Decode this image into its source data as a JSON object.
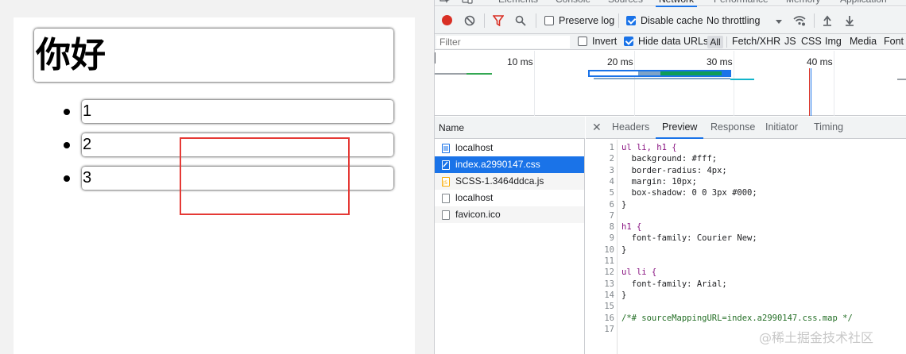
{
  "demo": {
    "heading": "你好",
    "items": [
      "1",
      "2",
      "3"
    ]
  },
  "devtools": {
    "main_tabs": [
      "Elements",
      "Console",
      "Sources",
      "Network",
      "Performance",
      "Memory",
      "Application"
    ],
    "active_main_tab": "Network",
    "toolbar": {
      "preserve_log": "Preserve log",
      "disable_cache": "Disable cache",
      "throttling": "No throttling"
    },
    "filter": {
      "placeholder": "Filter",
      "invert": "Invert",
      "hide_data_urls": "Hide data URLs",
      "types": [
        "All",
        "Fetch/XHR",
        "JS",
        "CSS",
        "Img",
        "Media",
        "Font"
      ]
    },
    "overview_ticks": [
      "10 ms",
      "20 ms",
      "30 ms",
      "40 ms"
    ],
    "requests_header": "Name",
    "requests": [
      {
        "name": "localhost",
        "icon": "document-icon"
      },
      {
        "name": "index.a2990147.css",
        "icon": "stylesheet-icon"
      },
      {
        "name": "SCSS-1.3464ddca.js",
        "icon": "script-icon"
      },
      {
        "name": "localhost",
        "icon": "blank-file-icon"
      },
      {
        "name": "favicon.ico",
        "icon": "blank-file-icon"
      }
    ],
    "detail_tabs": [
      "Headers",
      "Preview",
      "Response",
      "Initiator",
      "Timing"
    ],
    "active_detail_tab": "Preview",
    "code_lines": [
      "ul li, h1 {",
      "  background: #fff;",
      "  border-radius: 4px;",
      "  margin: 10px;",
      "  box-shadow: 0 0 3px #000;",
      "}",
      "",
      "h1 {",
      "  font-family: Courier New;",
      "}",
      "",
      "ul li {",
      "  font-family: Arial;",
      "}",
      "",
      "/*# sourceMappingURL=index.a2990147.css.map */",
      ""
    ]
  },
  "watermark": "@稀土掘金技术社区",
  "colors": {
    "accent": "#1a73e8",
    "highlight_box": "#e53935",
    "record": "#d93025"
  }
}
